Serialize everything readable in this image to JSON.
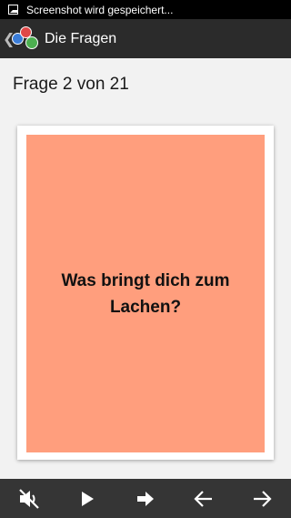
{
  "statusbar": {
    "notification_text": "Screenshot wird gespeichert..."
  },
  "actionbar": {
    "title": "Die Fragen",
    "back_glyph": "❮"
  },
  "progress": {
    "label": "Frage 2 von 21",
    "current": 2,
    "total": 21
  },
  "card": {
    "question": "Was bringt dich zum Lachen?",
    "color": "#ff9e7d"
  },
  "bottombar": {
    "buttons": [
      {
        "icon": "mute-icon"
      },
      {
        "icon": "play-icon"
      },
      {
        "icon": "arrow-forward-bold-icon"
      },
      {
        "icon": "arrow-back-icon"
      },
      {
        "icon": "arrow-forward-icon"
      }
    ]
  }
}
